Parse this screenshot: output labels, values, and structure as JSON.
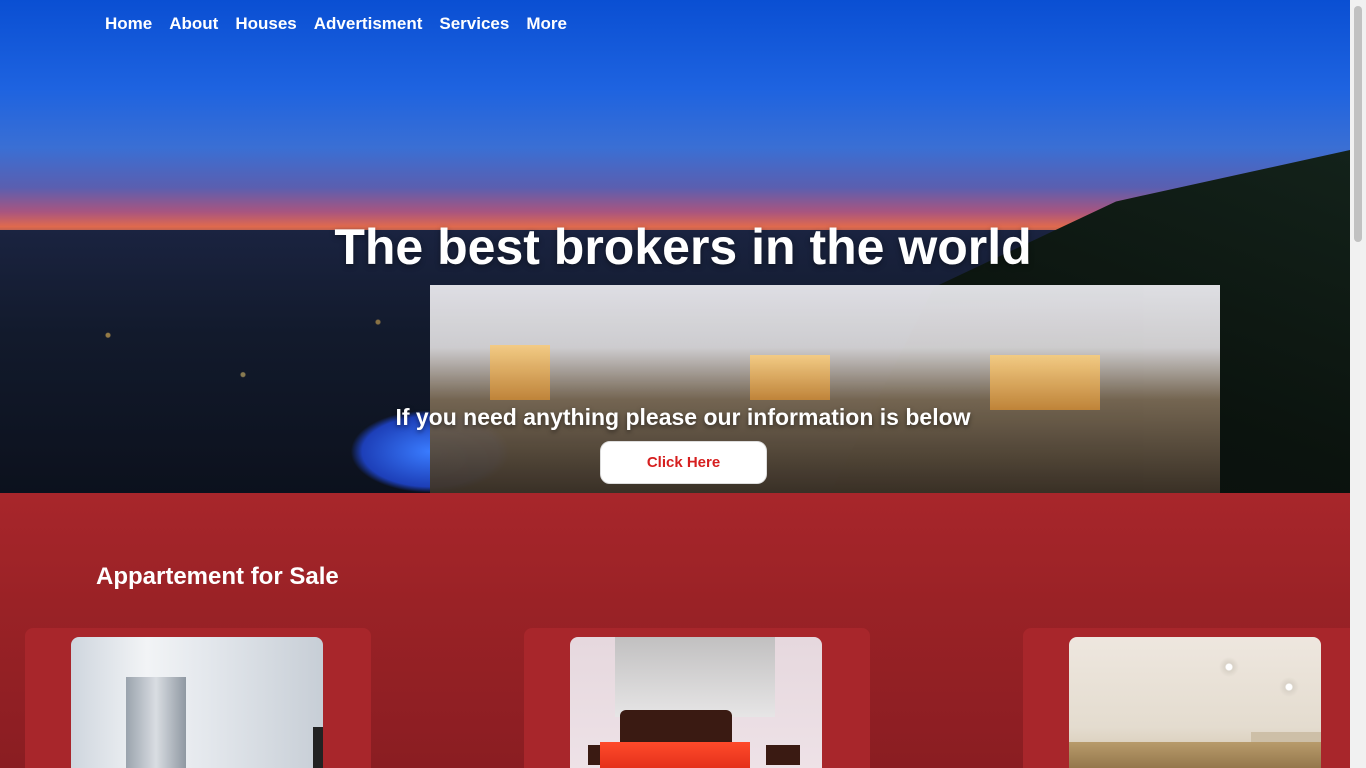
{
  "nav": {
    "items": [
      {
        "label": "Home"
      },
      {
        "label": "About"
      },
      {
        "label": "Houses"
      },
      {
        "label": "Advertisment"
      },
      {
        "label": "Services"
      },
      {
        "label": "More"
      }
    ]
  },
  "hero": {
    "title": "The best brokers in the world",
    "subtitle": "If you need anything please our information is below",
    "cta_label": "Click Here"
  },
  "sale": {
    "title": "Appartement for Sale"
  },
  "colors": {
    "section_red": "#a8262b",
    "cta_text": "#d61f1f"
  }
}
